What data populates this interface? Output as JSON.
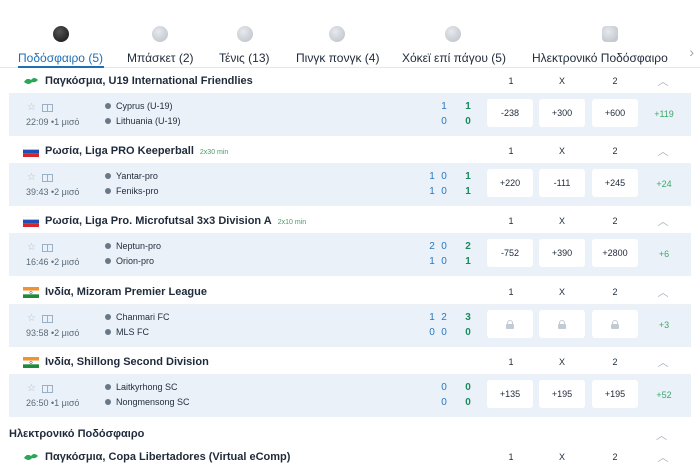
{
  "tabs": [
    {
      "label": "Ποδόσφαιρο (5)",
      "icon": "football-icon",
      "active": true
    },
    {
      "label": "Μπάσκετ (2)",
      "icon": "basketball-icon",
      "active": false
    },
    {
      "label": "Τένις (13)",
      "icon": "tennis-icon",
      "active": false
    },
    {
      "label": "Πινγκ πονγκ (4)",
      "icon": "table-tennis-icon",
      "active": false
    },
    {
      "label": "Χόκεϊ επί πάγου (5)",
      "icon": "ice-hockey-icon",
      "active": false
    },
    {
      "label": "Ηλεκτρονικό Ποδόσφαιρο",
      "icon": "gamepad-icon",
      "active": false
    }
  ],
  "columns": {
    "c1": "1",
    "cx": "X",
    "c2": "2"
  },
  "leagues": [
    {
      "name": "Παγκόσμια, U19 International Friendlies",
      "sub": "",
      "flag": "world",
      "match": {
        "time": "22:09 •1 μισό",
        "team1": "Cyprus (U-19)",
        "team2": "Lithuania (U-19)",
        "p1": [
          "1",
          "0"
        ],
        "p2": [],
        "t": [
          "1",
          "0"
        ],
        "odds": [
          "-238",
          "+300",
          "+600"
        ],
        "more": "+119"
      }
    },
    {
      "name": "Ρωσία, Liga PRO Keeperball",
      "sub": "2x30 min",
      "flag": "ru",
      "match": {
        "time": "39:43 •2 μισό",
        "team1": "Yantar-pro",
        "team2": "Feniks-pro",
        "p1": [
          "1",
          "1"
        ],
        "p2": [
          "0",
          "0"
        ],
        "t": [
          "1",
          "1"
        ],
        "odds": [
          "+220",
          "-111",
          "+245"
        ],
        "more": "+24"
      }
    },
    {
      "name": "Ρωσία, Liga Pro. Microfutsal 3x3 Division A",
      "sub": "2x10 min",
      "flag": "ru",
      "match": {
        "time": "16:46 •2 μισό",
        "team1": "Neptun-pro",
        "team2": "Orion-pro",
        "p1": [
          "2",
          "1"
        ],
        "p2": [
          "0",
          "0"
        ],
        "t": [
          "2",
          "1"
        ],
        "odds": [
          "-752",
          "+390",
          "+2800"
        ],
        "more": "+6"
      }
    },
    {
      "name": "Ινδία, Mizoram Premier League",
      "sub": "",
      "flag": "in",
      "match": {
        "time": "93:58 •2 μισό",
        "team1": "Chanmari FC",
        "team2": "MLS FC",
        "p1": [
          "1",
          "0"
        ],
        "p2": [
          "2",
          "0"
        ],
        "t": [
          "3",
          "0"
        ],
        "odds": [],
        "more": "+3"
      }
    },
    {
      "name": "Ινδία, Shillong Second Division",
      "sub": "",
      "flag": "in",
      "match": {
        "time": "26:50 •1 μισό",
        "team1": "Laitkyrhong SC",
        "team2": "Nongmensong SC",
        "p1": [
          "0",
          "0"
        ],
        "p2": [],
        "t": [
          "0",
          "0"
        ],
        "odds": [
          "+135",
          "+195",
          "+195"
        ],
        "more": "+52"
      }
    }
  ],
  "section": {
    "title": "Ηλεκτρονικό Ποδόσφαιρο"
  },
  "esport_league": {
    "name": "Παγκόσμια, Copa Libertadores (Virtual eComp)",
    "flag": "world"
  },
  "colors": {
    "accent": "#1f6fb5",
    "row_bg": "#eaf1f8",
    "score_green": "#1a8a5c",
    "score_blue": "#2a77c0"
  }
}
